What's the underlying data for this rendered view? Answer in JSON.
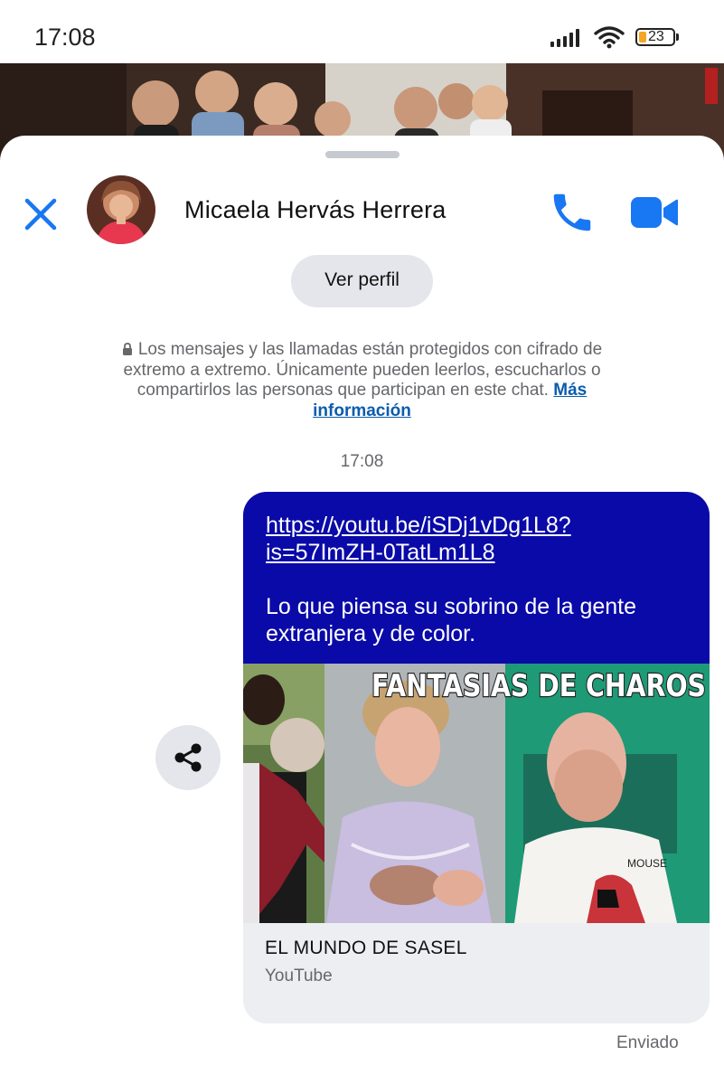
{
  "status_bar": {
    "time": "17:08",
    "battery": "23"
  },
  "header": {
    "contact_name": "Micaela Hervás Herrera"
  },
  "profile_button": {
    "label": "Ver perfil"
  },
  "encryption_notice": {
    "text": "Los mensajes y las llamadas están protegidos con cifrado de extremo a extremo. Únicamente pueden leerlos, escucharlos o compartirlos las personas que participan en este chat.",
    "link": "Más información"
  },
  "conversation": {
    "timestamp": "17:08",
    "message": {
      "link": "https://youtu.be/iSDj1vDg1L8?is=57ImZH-0TatLm1L8",
      "body": "Lo que piensa su sobrino de la gente extranjera y de color.",
      "preview": {
        "thumbnail_text": "FANTASIAS DE CHAROS",
        "title": "EL MUNDO DE SASEL",
        "site": "YouTube",
        "shirt_text": "MOUSE"
      },
      "status": "Enviado"
    }
  },
  "colors": {
    "accent": "#0a7cff",
    "bubble": "#0a0aa8",
    "link": "#0b5cad"
  }
}
